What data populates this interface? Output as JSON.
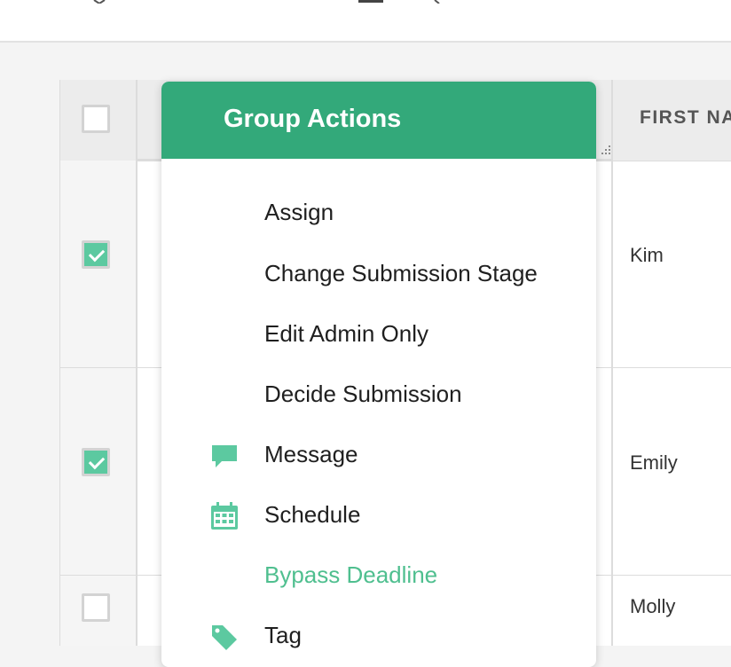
{
  "colors": {
    "accent": "#33a97a",
    "accent_light": "#5cc9a0",
    "highlight_text": "#4fbf8f"
  },
  "table": {
    "header": {
      "column_label": "FIRST NA"
    },
    "rows": [
      {
        "first_name": "Kim",
        "checked": true
      },
      {
        "first_name": "Emily",
        "checked": true
      },
      {
        "first_name": "Molly",
        "checked": false
      }
    ]
  },
  "dropdown": {
    "title": "Group Actions",
    "items": [
      {
        "label": "Assign",
        "icon": ""
      },
      {
        "label": "Change Submission Stage",
        "icon": ""
      },
      {
        "label": "Edit Admin Only",
        "icon": ""
      },
      {
        "label": "Decide Submission",
        "icon": ""
      },
      {
        "label": "Message",
        "icon": "speech-bubble-icon"
      },
      {
        "label": "Schedule",
        "icon": "calendar-icon"
      },
      {
        "label": "Bypass Deadline",
        "icon": ""
      },
      {
        "label": "Tag",
        "icon": "tag-icon"
      }
    ]
  }
}
